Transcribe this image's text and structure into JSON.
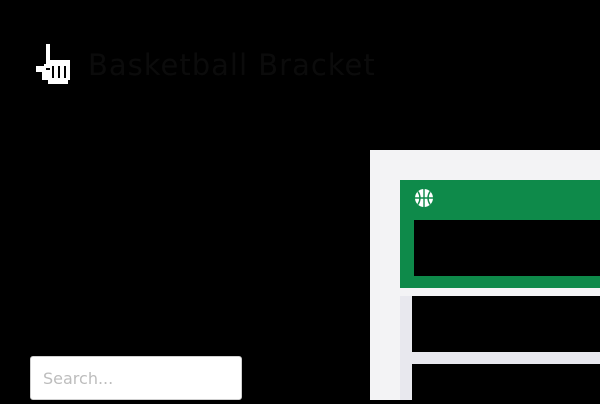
{
  "app": {
    "title": "Basketball Bracket",
    "cursor_icon": "pixel-hand-pointer-icon"
  },
  "search": {
    "placeholder": "Search..."
  },
  "preview": {
    "header_icon": "basketball-icon",
    "accent_color": "#0e8a4a"
  }
}
